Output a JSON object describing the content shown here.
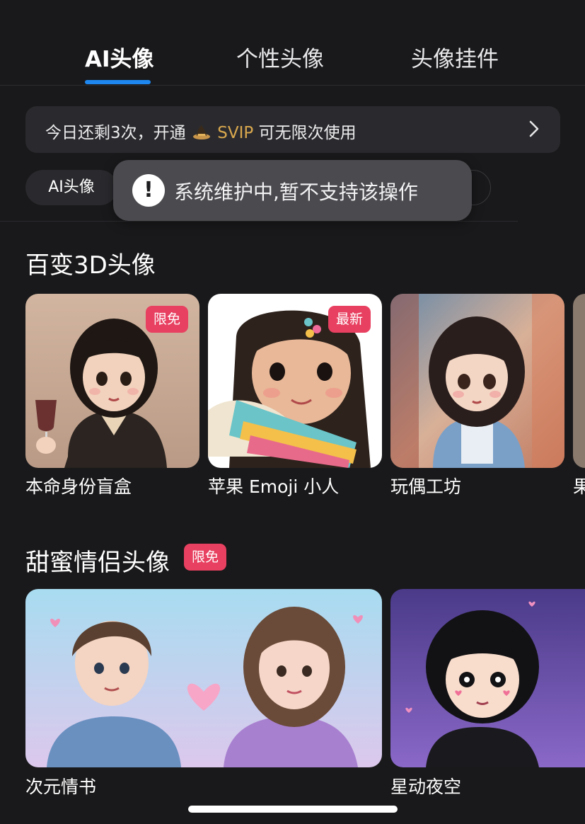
{
  "tabs": [
    {
      "label": "AI头像",
      "active": true
    },
    {
      "label": "个性头像",
      "active": false
    },
    {
      "label": "头像挂件",
      "active": false
    }
  ],
  "banner": {
    "text_before": "今日还剩3次，开通",
    "svip": "SVIP",
    "text_after": "可无限次使用",
    "icon": "crown-icon"
  },
  "chips": {
    "first": "AI头像"
  },
  "toast": {
    "message": "系统维护中,暂不支持该操作",
    "icon": "exclamation-icon"
  },
  "sections": [
    {
      "title": "百变3D头像",
      "cards": [
        {
          "label": "本命身份盲盒",
          "badge": "限免"
        },
        {
          "label": "苹果 Emoji 小人",
          "badge": "最新"
        },
        {
          "label": "玩偶工坊",
          "badge": ""
        },
        {
          "label": "果",
          "badge": ""
        }
      ]
    },
    {
      "title": "甜蜜情侣头像",
      "badge": "限免",
      "cards": [
        {
          "label": "次元情书"
        },
        {
          "label": "星动夜空"
        }
      ]
    }
  ],
  "colors": {
    "accent": "#1e88f0",
    "svip_gold": "#d9a84e",
    "badge": "#e84060",
    "background": "#19191b"
  }
}
